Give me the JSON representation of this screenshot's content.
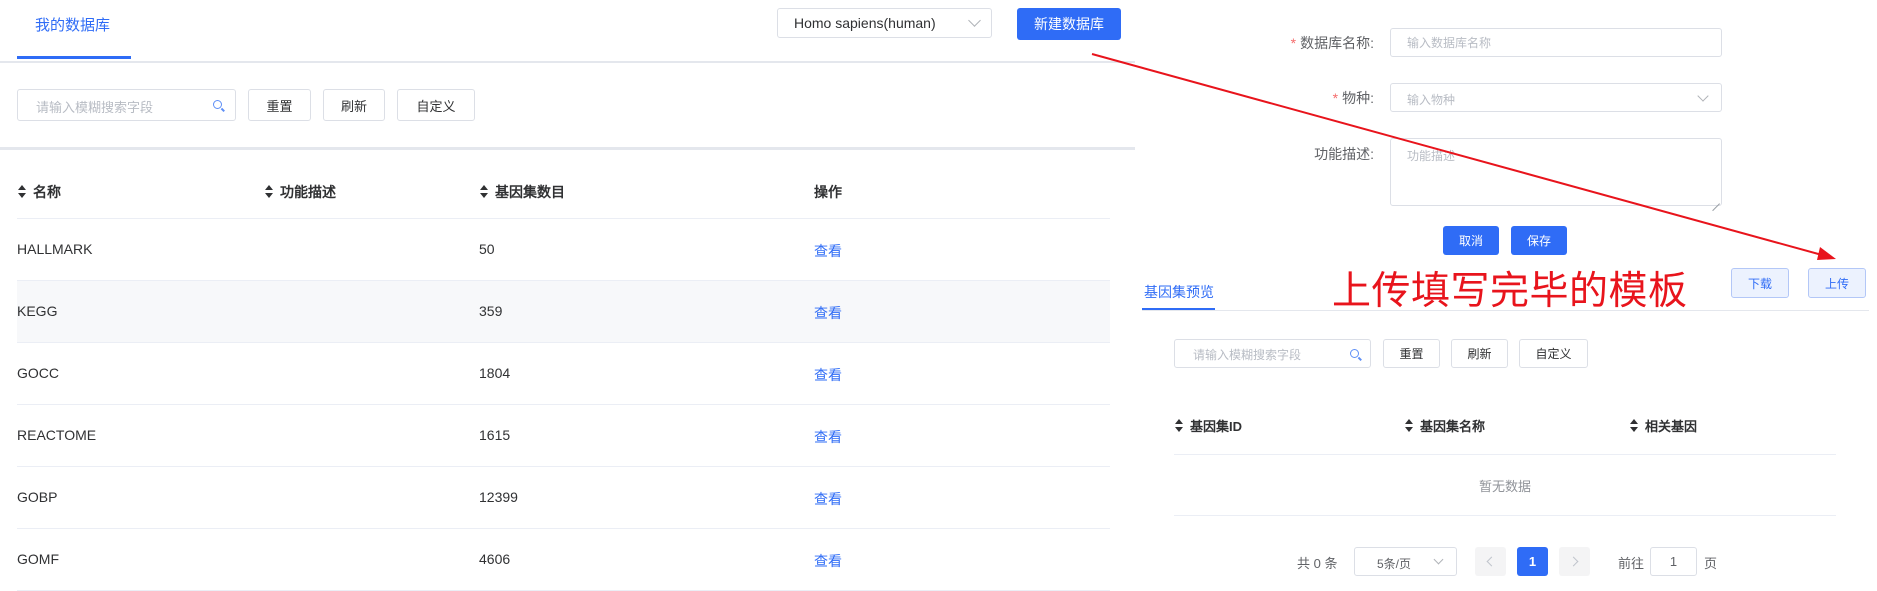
{
  "left": {
    "tab": "我的数据库",
    "species_select": "Homo sapiens(human)",
    "new_db_button": "新建数据库",
    "search_placeholder": "请输入模糊搜索字段",
    "reset": "重置",
    "refresh": "刷新",
    "custom": "自定义",
    "columns": [
      "名称",
      "功能描述",
      "基因集数目",
      "操作"
    ],
    "rows": [
      {
        "name": "HALLMARK",
        "desc": "",
        "count": "50",
        "action": "查看"
      },
      {
        "name": "KEGG",
        "desc": "",
        "count": "359",
        "action": "查看"
      },
      {
        "name": "GOCC",
        "desc": "",
        "count": "1804",
        "action": "查看"
      },
      {
        "name": "REACTOME",
        "desc": "",
        "count": "1615",
        "action": "查看"
      },
      {
        "name": "GOBP",
        "desc": "",
        "count": "12399",
        "action": "查看"
      },
      {
        "name": "GOMF",
        "desc": "",
        "count": "4606",
        "action": "查看"
      }
    ]
  },
  "form": {
    "db_name_label": "数据库名称:",
    "db_name_placeholder": "输入数据库名称",
    "species_label": "物种:",
    "species_placeholder": "输入物种",
    "desc_label": "功能描述:",
    "desc_placeholder": "功能描述",
    "cancel": "取消",
    "save": "保存"
  },
  "preview": {
    "tab": "基因集预览",
    "annotation": "上传填写完毕的模板",
    "download": "下载",
    "upload": "上传",
    "search_placeholder": "请输入模糊搜索字段",
    "reset": "重置",
    "refresh": "刷新",
    "custom": "自定义",
    "columns": [
      "基因集ID",
      "基因集名称",
      "相关基因"
    ],
    "empty_text": "暂无数据",
    "pagination": {
      "total": "共 0 条",
      "page_size": "5条/页",
      "current_page": "1",
      "goto_label": "前往",
      "goto_value": "1",
      "page_suffix": "页"
    }
  },
  "colors": {
    "primary": "#2f6cf6",
    "annotation_red": "#e8141c",
    "required_star": "#f56c6c"
  }
}
